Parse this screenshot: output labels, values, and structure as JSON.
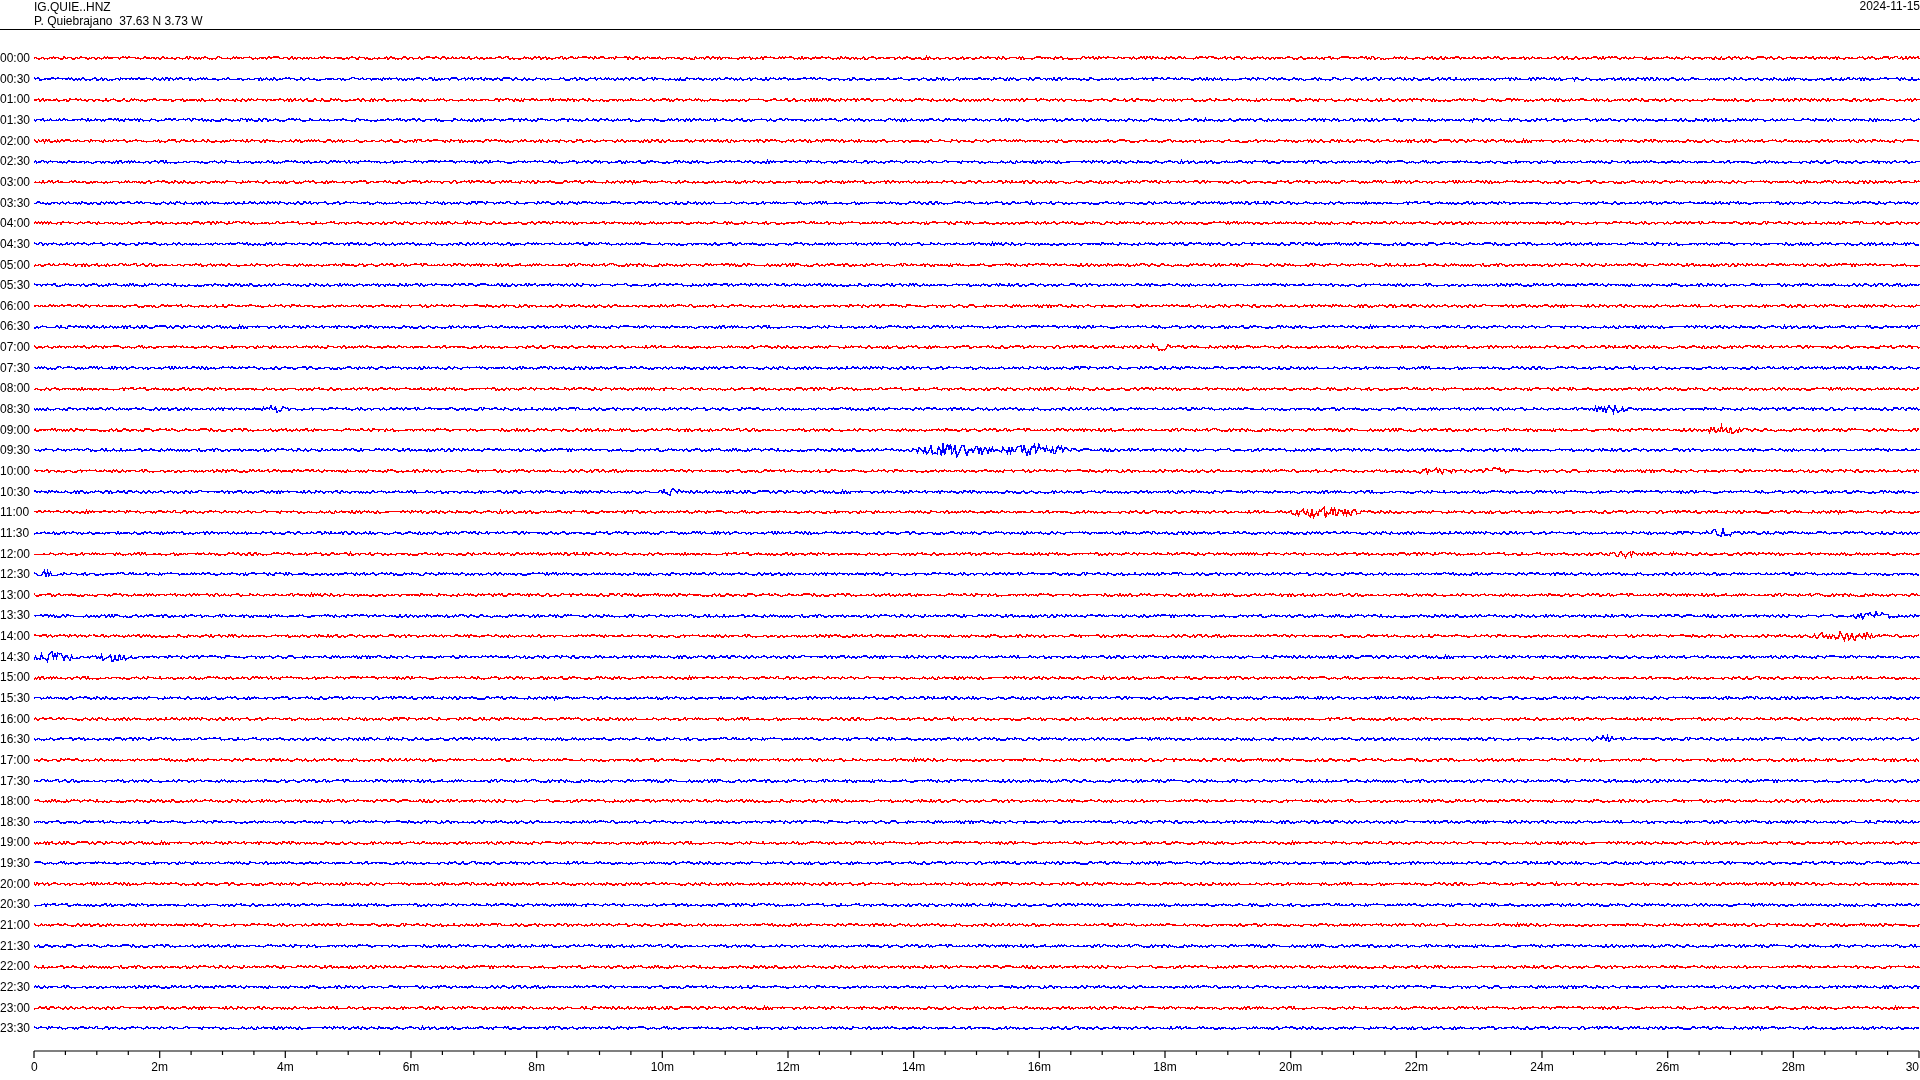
{
  "header": {
    "station_code": "IG.QUIE..HNZ",
    "station_info": "P. Quiebrajano  37.63 N 3.73 W",
    "date": "2024-11-15"
  },
  "traces": [
    {
      "label": "00:00",
      "color": "#ff0000"
    },
    {
      "label": "00:30",
      "color": "#0000ff"
    },
    {
      "label": "01:00",
      "color": "#ff0000"
    },
    {
      "label": "01:30",
      "color": "#0000ff"
    },
    {
      "label": "02:00",
      "color": "#ff0000"
    },
    {
      "label": "02:30",
      "color": "#0000ff"
    },
    {
      "label": "03:00",
      "color": "#ff0000"
    },
    {
      "label": "03:30",
      "color": "#0000ff"
    },
    {
      "label": "04:00",
      "color": "#ff0000"
    },
    {
      "label": "04:30",
      "color": "#0000ff"
    },
    {
      "label": "05:00",
      "color": "#ff0000"
    },
    {
      "label": "05:30",
      "color": "#0000ff"
    },
    {
      "label": "06:00",
      "color": "#ff0000"
    },
    {
      "label": "06:30",
      "color": "#0000ff"
    },
    {
      "label": "07:00",
      "color": "#ff0000"
    },
    {
      "label": "07:30",
      "color": "#0000ff"
    },
    {
      "label": "08:00",
      "color": "#ff0000"
    },
    {
      "label": "08:30",
      "color": "#0000ff"
    },
    {
      "label": "09:00",
      "color": "#ff0000"
    },
    {
      "label": "09:30",
      "color": "#0000ff"
    },
    {
      "label": "10:00",
      "color": "#ff0000"
    },
    {
      "label": "10:30",
      "color": "#0000ff"
    },
    {
      "label": "11:00",
      "color": "#ff0000"
    },
    {
      "label": "11:30",
      "color": "#0000ff"
    },
    {
      "label": "12:00",
      "color": "#ff0000"
    },
    {
      "label": "12:30",
      "color": "#0000ff"
    },
    {
      "label": "13:00",
      "color": "#ff0000"
    },
    {
      "label": "13:30",
      "color": "#0000ff"
    },
    {
      "label": "14:00",
      "color": "#ff0000"
    },
    {
      "label": "14:30",
      "color": "#0000ff"
    },
    {
      "label": "15:00",
      "color": "#ff0000"
    },
    {
      "label": "15:30",
      "color": "#0000ff"
    },
    {
      "label": "16:00",
      "color": "#ff0000"
    },
    {
      "label": "16:30",
      "color": "#0000ff"
    },
    {
      "label": "17:00",
      "color": "#ff0000"
    },
    {
      "label": "17:30",
      "color": "#0000ff"
    },
    {
      "label": "18:00",
      "color": "#ff0000"
    },
    {
      "label": "18:30",
      "color": "#0000ff"
    },
    {
      "label": "19:00",
      "color": "#ff0000"
    },
    {
      "label": "19:30",
      "color": "#0000ff"
    },
    {
      "label": "20:00",
      "color": "#ff0000"
    },
    {
      "label": "20:30",
      "color": "#0000ff"
    },
    {
      "label": "21:00",
      "color": "#ff0000"
    },
    {
      "label": "21:30",
      "color": "#0000ff"
    },
    {
      "label": "22:00",
      "color": "#ff0000"
    },
    {
      "label": "22:30",
      "color": "#0000ff"
    },
    {
      "label": "23:00",
      "color": "#ff0000"
    },
    {
      "label": "23:30",
      "color": "#0000ff"
    }
  ],
  "time_axis": {
    "labels": [
      "0",
      "2m",
      "4m",
      "6m",
      "8m",
      "10m",
      "12m",
      "14m",
      "16m",
      "18m",
      "20m",
      "22m",
      "24m",
      "26m",
      "28m",
      "30"
    ]
  }
}
